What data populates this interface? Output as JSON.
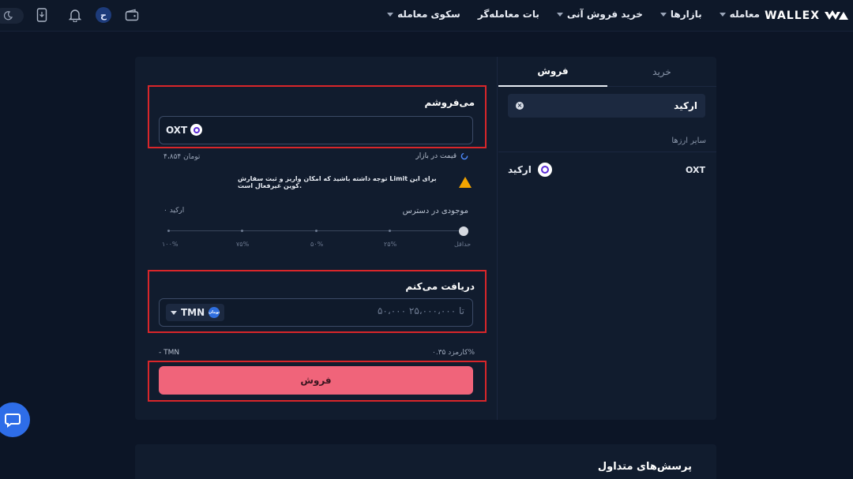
{
  "header": {
    "brand": "WALLEX",
    "nav": [
      {
        "label": "معامله",
        "has_caret": true
      },
      {
        "label": "بازارها",
        "has_caret": true
      },
      {
        "label": "خرید فروش آنی",
        "has_caret": true
      },
      {
        "label": "بات معامله‌گر",
        "has_caret": false
      },
      {
        "label": "سکوی معامله",
        "has_caret": true
      }
    ],
    "user_badge": "ح",
    "icons": [
      "wallet-icon",
      "user-badge",
      "bell-icon",
      "phone-icon",
      "moon-icon"
    ]
  },
  "right": {
    "tabs": [
      {
        "label": "خرید",
        "active": false
      },
      {
        "label": "فروش",
        "active": true
      }
    ],
    "search_value": "ارکید",
    "other_label": "سایر ارزها",
    "coin": {
      "name": "ارکید",
      "symbol": "OXT"
    }
  },
  "sell": {
    "label": "می‌فروشم",
    "coin_symbol": "OXT",
    "market_price_label": "قیمت در بازار",
    "market_price_value": "۴،۸۵۴ تومان",
    "warning": "توجه داشته باشید که امکان واریز و ثبت سفارش Limit برای این کوین غیرفعال است.",
    "available_label": "موجودی در دسترس",
    "available_value": "۰ ارکید",
    "slider_labels": [
      "حداقل",
      "۲۵%",
      "۵۰%",
      "۷۵%",
      "۱۰۰%"
    ],
    "slider_percent": 0
  },
  "receive": {
    "label": "دریافت می‌کنم",
    "placeholder": "۵۰،۰۰۰ تا ۲۵،۰۰۰،۰۰۰",
    "currency": "TMN",
    "currency_badge": "تومان",
    "fee_label": "کارمزد ۰.۳۵%",
    "fee_value": "- TMN"
  },
  "submit_label": "فروش",
  "faq_title": "پرسش‌های متداول",
  "colors": {
    "accent": "#f0647a",
    "highlight": "#d9262a",
    "warning": "#f2a400",
    "chat": "#2e6de8"
  }
}
